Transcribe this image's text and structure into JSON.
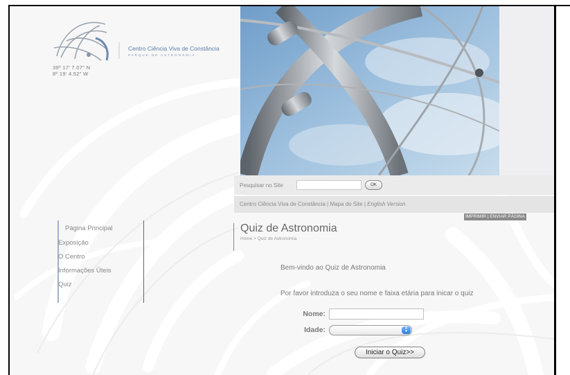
{
  "logo": {
    "name": "Centro Ciência Viva de Constância",
    "subtitle": "PARQUE DE ASTRONOMIA"
  },
  "coordinates": {
    "latitude": "39º 17' 7.07\" N",
    "longitude": "8º 19' 4.52\" W"
  },
  "search": {
    "label": "Pesquisar no Site",
    "value": "",
    "button_label": "OK"
  },
  "top_links": {
    "centro": "Centro Ciência Viva de Constância",
    "separator": " | ",
    "mapa": "Mapa do Site",
    "english": "English Version"
  },
  "utility_links": {
    "text": "IMPRIMIR | ENVIAR PÁGINA"
  },
  "page": {
    "title": "Quiz de Astronomia",
    "breadcrumb": "Home > Quiz de Astronomia"
  },
  "nav": {
    "items": [
      {
        "label": "Página Principal"
      },
      {
        "label": "Exposição"
      },
      {
        "label": "O Centro"
      },
      {
        "label": "Informações Úteis"
      },
      {
        "label": "Quiz"
      }
    ]
  },
  "quiz": {
    "welcome": "Bem-vindo ao Quiz de Astronomia",
    "instructions": "Por favor introduza o seu nome e faixa etária para inicar o quiz",
    "name_label": "Nome:",
    "name_value": "",
    "age_label": "Idade:",
    "age_selected": "",
    "start_button": "Iniciar o Quiz>>"
  },
  "colors": {
    "nav_rule": "#9db2c8",
    "select_accent": "#2f7de0",
    "sky": "#8fb4d6",
    "metal": "#9aa0a6"
  }
}
